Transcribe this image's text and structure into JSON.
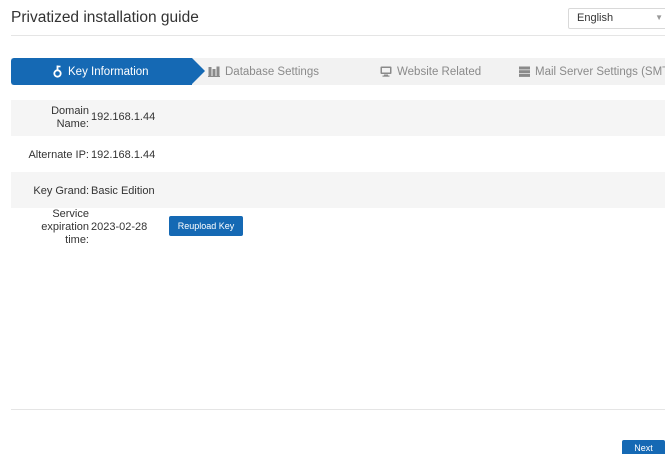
{
  "header": {
    "title": "Privatized installation guide",
    "language": "English"
  },
  "steps": [
    {
      "label": "Key Information",
      "icon": "key-icon",
      "active": true
    },
    {
      "label": "Database Settings",
      "icon": "database-icon",
      "active": false
    },
    {
      "label": "Website Related",
      "icon": "monitor-icon",
      "active": false
    },
    {
      "label": "Mail Server Settings (SMTP",
      "icon": "server-icon",
      "active": false
    }
  ],
  "fields": [
    {
      "label_line1": "Domain",
      "label_line2": "Name:",
      "value": "192.168.1.44"
    },
    {
      "label": "Alternate IP:",
      "value": "192.168.1.44"
    },
    {
      "label": "Key Grand:",
      "value": "Basic Edition"
    },
    {
      "label_line1": "Service",
      "label_line2": "expiration",
      "label_line3": "time:",
      "value": "2023-02-28"
    }
  ],
  "actions": {
    "reupload_key": "Reupload Key",
    "next": "Next"
  },
  "colors": {
    "accent": "#1569b4",
    "step_bar_bg": "#f2f2f2",
    "row_shade": "#f5f5f5"
  }
}
